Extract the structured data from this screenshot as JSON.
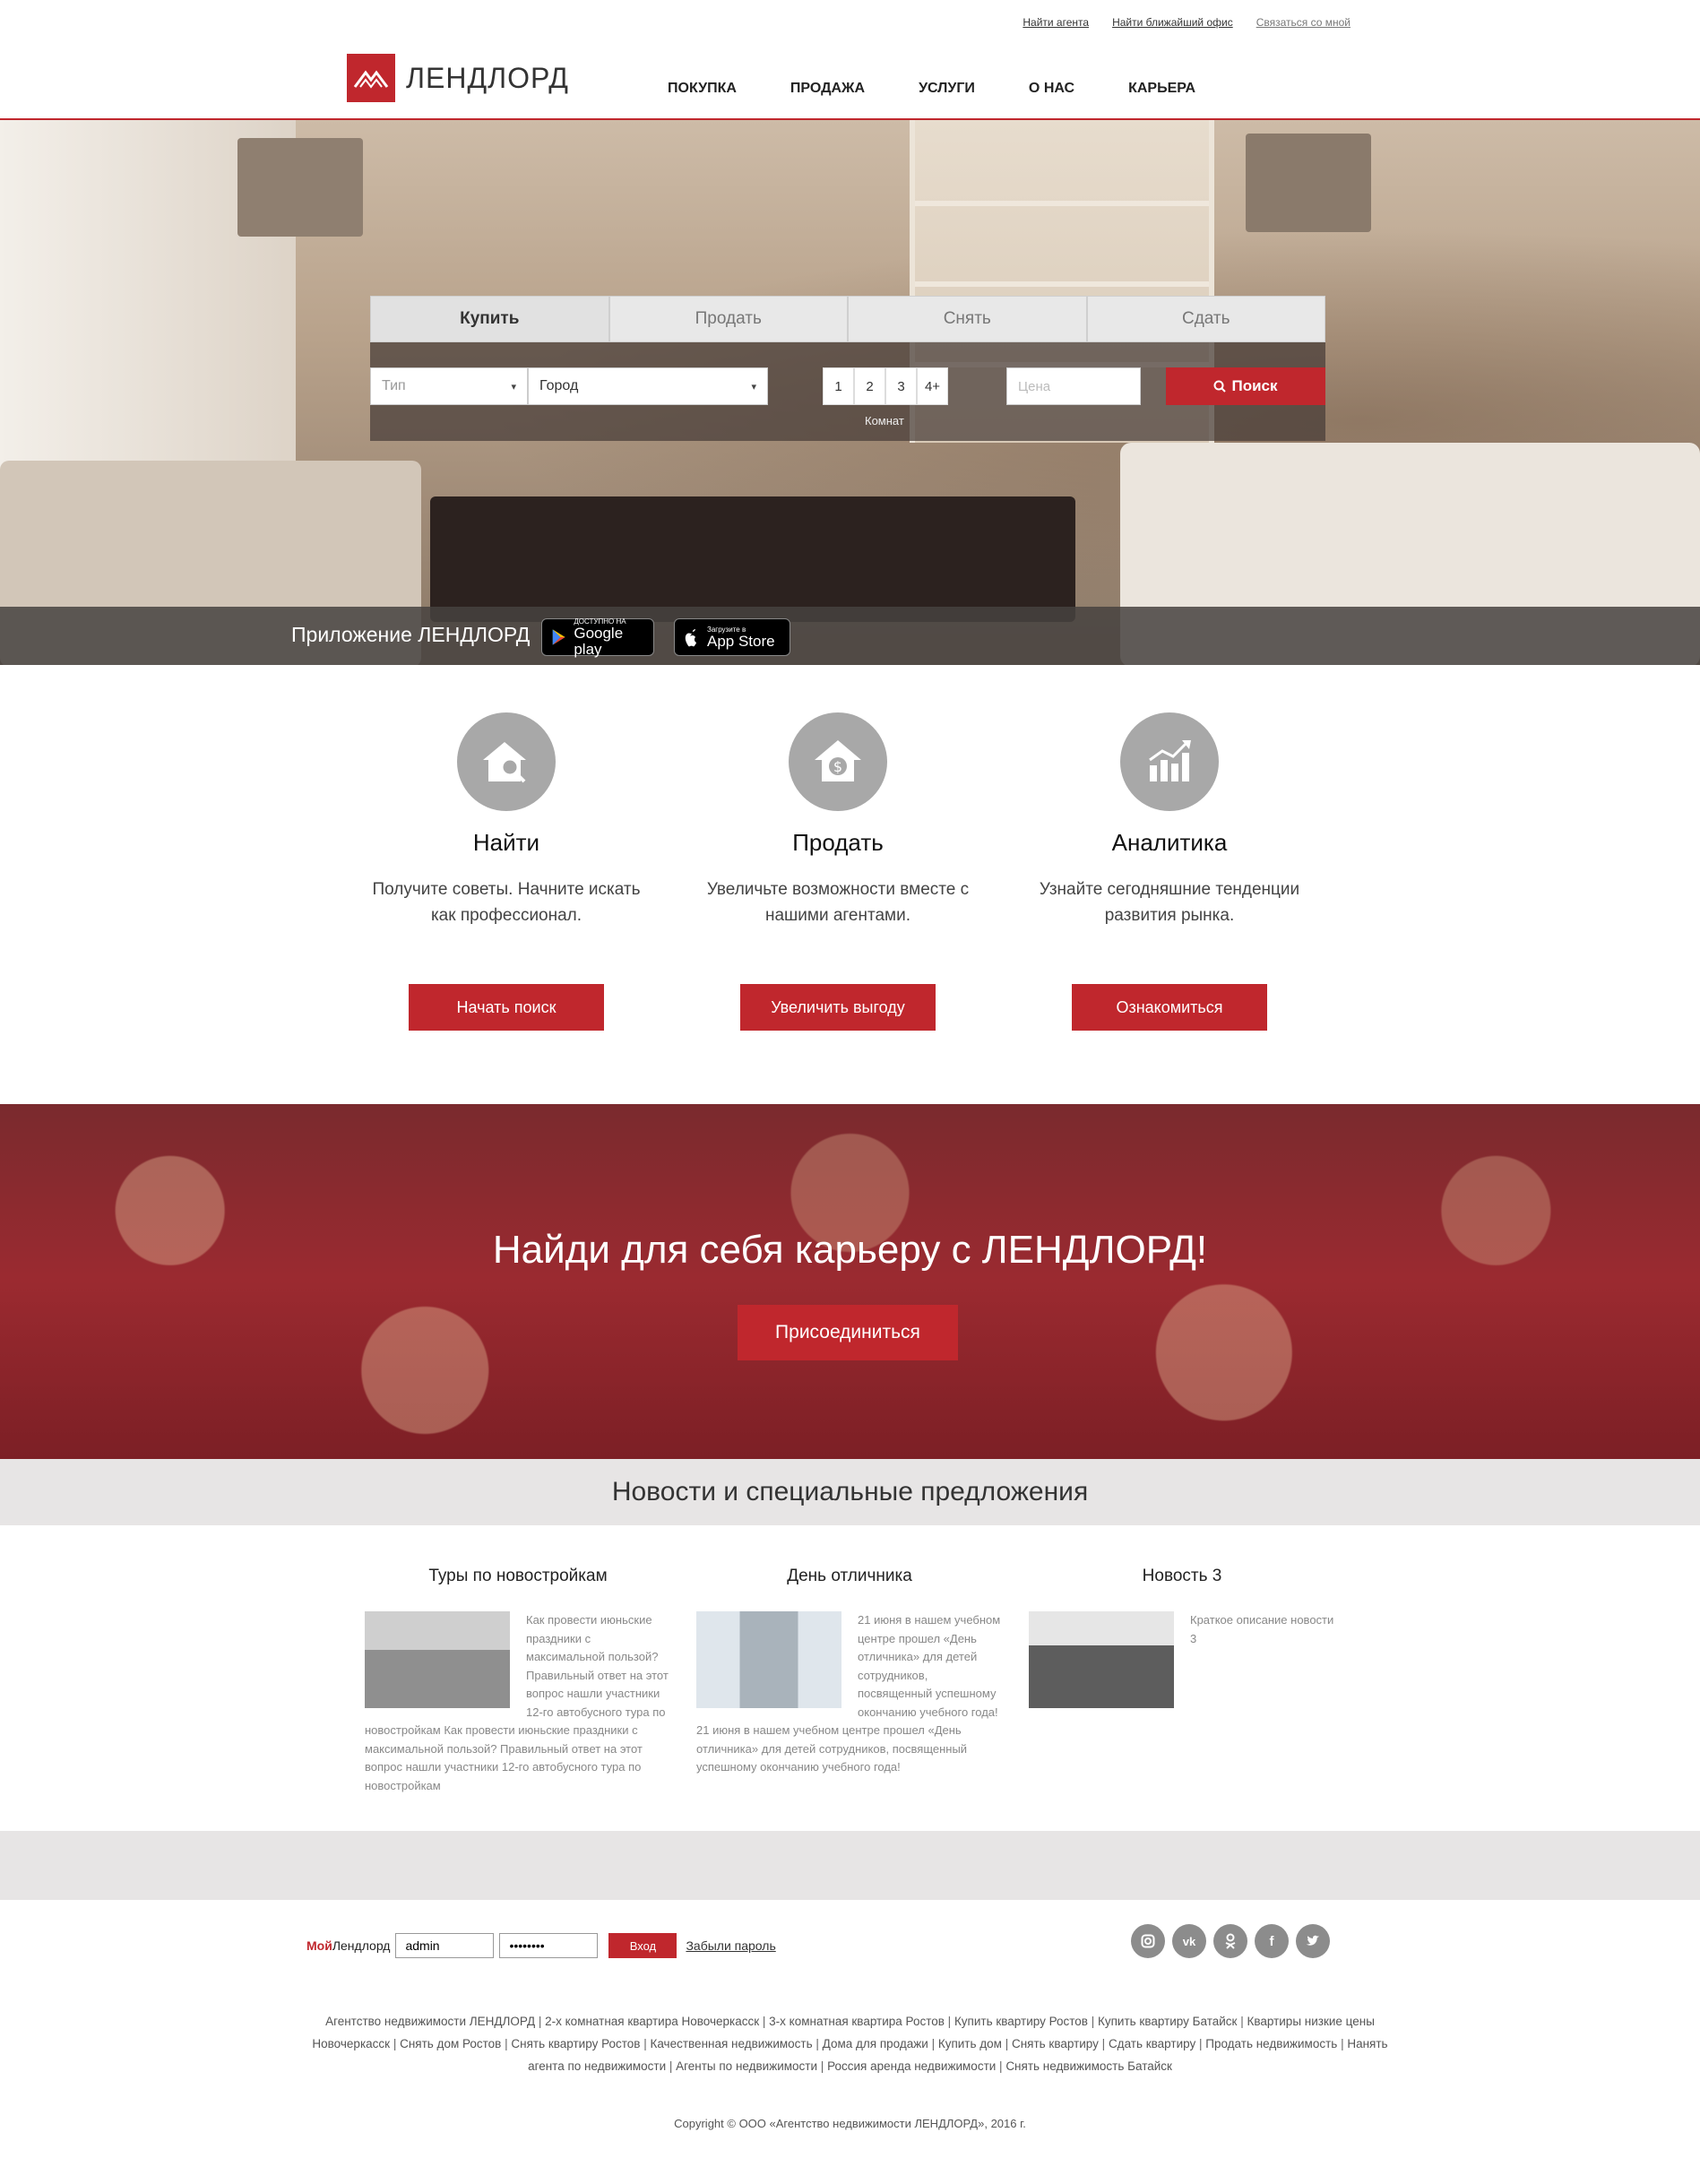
{
  "top_links": [
    "Найти агента",
    "Найти ближайший офис",
    "Связаться со мной"
  ],
  "logo_text": "ЛЕНДЛОРД",
  "nav": [
    "ПОКУПКА",
    "ПРОДАЖА",
    "УСЛУГИ",
    "О НАС",
    "КАРЬЕРА"
  ],
  "search": {
    "tabs": [
      "Купить",
      "Продать",
      "Снять",
      "Сдать"
    ],
    "active_tab": "Купить",
    "type_placeholder": "Тип",
    "city_placeholder": "Город",
    "rooms": [
      "1",
      "2",
      "3",
      "4+"
    ],
    "rooms_label": "Комнат",
    "price_placeholder": "Цена",
    "button": "Поиск"
  },
  "app": {
    "label": "Приложение ЛЕНДЛОРД",
    "google_small": "ДОСТУПНО НА",
    "google_big": "Google play",
    "apple_small": "Загрузите в",
    "apple_big": "App Store"
  },
  "features": [
    {
      "icon": "house-search-icon",
      "title": "Найти",
      "desc": "Получите советы. Начните искать как профессионал.",
      "button": "Начать поиск"
    },
    {
      "icon": "house-dollar-icon",
      "title": "Продать",
      "desc": "Увеличьте возможности вместе с нашими агентами.",
      "button": "Увеличить выгоду"
    },
    {
      "icon": "chart-growth-icon",
      "title": "Аналитика",
      "desc": "Узнайте сегодняшние тенденции развития рынка.",
      "button": "Ознакомиться"
    }
  ],
  "career": {
    "title": "Найди для себя карьеру с ЛЕНДЛОРД!",
    "button": "Присоединиться"
  },
  "news_heading": "Новости и специальные предложения",
  "news": [
    {
      "title": "Туры по новостройкам",
      "text": "Как провести июньские праздники с максимальной пользой? Правильный ответ на этот вопрос нашли участники 12-го автобусного тура по новостройкам Как провести июньские праздники с максимальной пользой? Правильный ответ на этот вопрос нашли участники 12-го автобусного тура по новостройкам"
    },
    {
      "title": "День отличника",
      "text": "21 июня в нашем учебном центре прошел «День отличника» для детей сотрудников, посвященный успешному окончанию учебного года! 21 июня в нашем учебном центре прошел «День отличника» для детей сотрудников, посвященный успешному окончанию учебного года!"
    },
    {
      "title": "Новость 3",
      "text": "Краткое описание новости 3"
    }
  ],
  "login": {
    "brand_red": "Мой",
    "brand_dark": "Лендлорд",
    "username_value": "admin",
    "password_value": "••••••••",
    "enter_button": "Вход",
    "forgot": "Забыли пароль"
  },
  "socials": [
    "instagram-icon",
    "vk-icon",
    "odnoklassniki-icon",
    "facebook-icon",
    "twitter-icon"
  ],
  "seo_links": [
    "Агентство недвижимости ЛЕНДЛОРД",
    "2-х комнатная квартира Новочеркасск",
    "3-х комнатная квартира Ростов",
    "Купить квартиру Ростов",
    "Купить квартиру Батайск",
    "Квартиры низкие цены Новочеркасск",
    "Снять дом Ростов",
    "Снять квартиру Ростов",
    "Качественная недвижимость",
    "Дома для продажи",
    "Купить дом",
    "Снять квартиру",
    "Сдать квартиру",
    "Продать недвижимость",
    "Нанять агента по недвижимости",
    "Агенты по недвижимости",
    "Россия аренда недвижимости",
    "Снять недвижимость Батайск"
  ],
  "copyright": "Copyright © ООО «Агентство недвижимости ЛЕНДЛОРД», 2016 г.",
  "colors": {
    "accent": "#c0272d",
    "band": "#e7e5e5",
    "icon_circle": "#a8a8a8"
  }
}
